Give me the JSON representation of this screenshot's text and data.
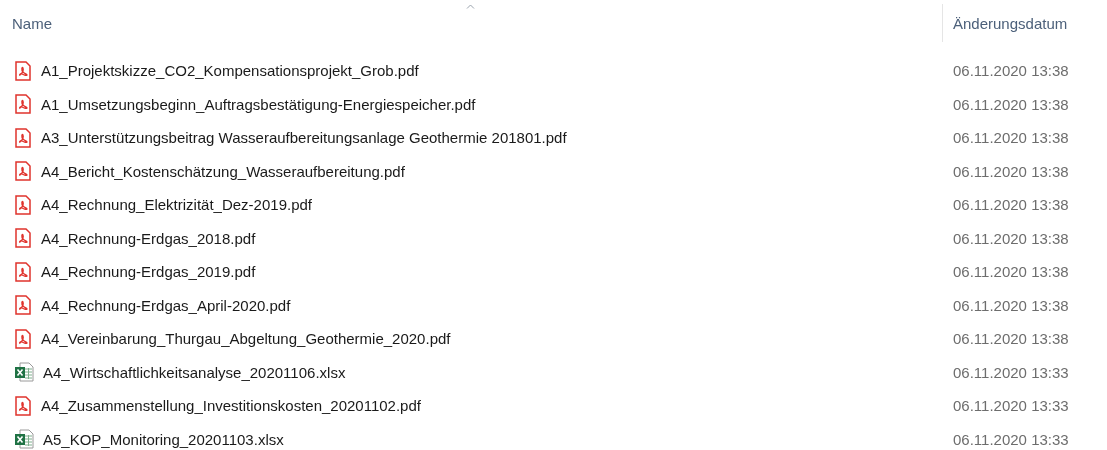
{
  "columns": [
    {
      "label": "Name"
    },
    {
      "label": "Änderungsdatum"
    }
  ],
  "files": [
    {
      "kind": "pdf",
      "name": "A1_Projektskizze_CO2_Kompensationsprojekt_Grob.pdf",
      "date": "06.11.2020 13:38"
    },
    {
      "kind": "pdf",
      "name": "A1_Umsetzungsbeginn_Auftragsbestätigung-Energiespeicher.pdf",
      "date": "06.11.2020 13:38"
    },
    {
      "kind": "pdf",
      "name": "A3_Unterstützungsbeitrag Wasseraufbereitungsanlage Geothermie 201801.pdf",
      "date": "06.11.2020 13:38"
    },
    {
      "kind": "pdf",
      "name": "A4_Bericht_Kostenschätzung_Wasseraufbereitung.pdf",
      "date": "06.11.2020 13:38"
    },
    {
      "kind": "pdf",
      "name": "A4_Rechnung_Elektrizität_Dez-2019.pdf",
      "date": "06.11.2020 13:38"
    },
    {
      "kind": "pdf",
      "name": "A4_Rechnung-Erdgas_2018.pdf",
      "date": "06.11.2020 13:38"
    },
    {
      "kind": "pdf",
      "name": "A4_Rechnung-Erdgas_2019.pdf",
      "date": "06.11.2020 13:38"
    },
    {
      "kind": "pdf",
      "name": "A4_Rechnung-Erdgas_April-2020.pdf",
      "date": "06.11.2020 13:38"
    },
    {
      "kind": "pdf",
      "name": "A4_Vereinbarung_Thurgau_Abgeltung_Geothermie_2020.pdf",
      "date": "06.11.2020 13:38"
    },
    {
      "kind": "xlsx",
      "name": "A4_Wirtschaftlichkeitsanalyse_20201106.xlsx",
      "date": "06.11.2020 13:33"
    },
    {
      "kind": "pdf",
      "name": "A4_Zusammenstellung_Investitionskosten_20201102.pdf",
      "date": "06.11.2020 13:33"
    },
    {
      "kind": "xlsx",
      "name": "A5_KOP_Monitoring_20201103.xlsx",
      "date": "06.11.2020 13:33"
    }
  ]
}
